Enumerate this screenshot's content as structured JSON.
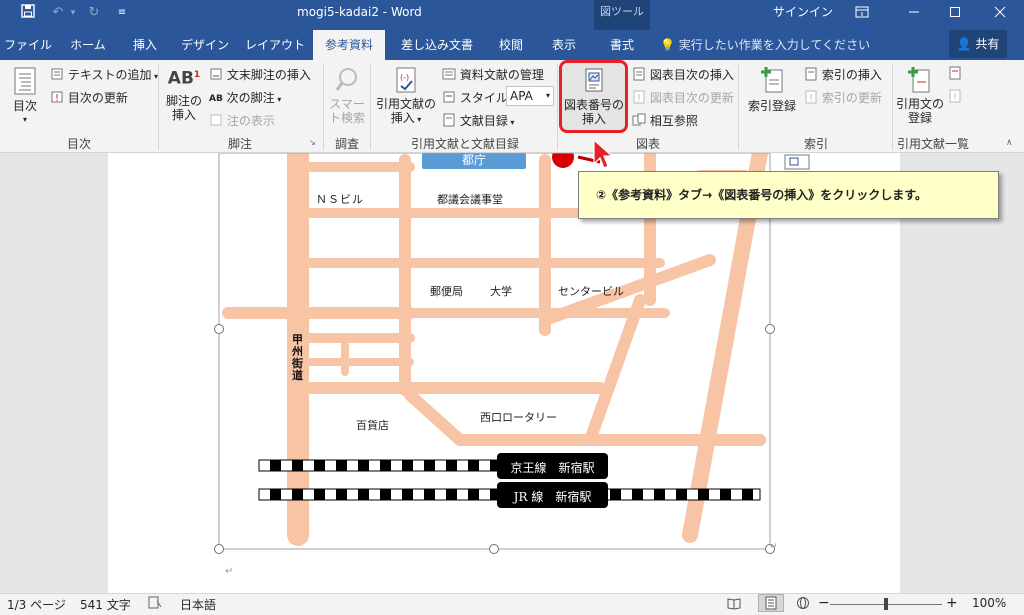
{
  "window": {
    "title": "mogi5-kadai2  -  Word",
    "signin": "サインイン",
    "context_tab_group": "図ツール"
  },
  "tabs": [
    "ファイル",
    "ホーム",
    "挿入",
    "デザイン",
    "レイアウト",
    "参考資料",
    "差し込み文書",
    "校閲",
    "表示",
    "書式"
  ],
  "active_tab": "参考資料",
  "tell_me": "実行したい作業を入力してください",
  "share": "共有",
  "ribbon": {
    "toc": {
      "toc_button": "目次",
      "add_text": "テキストの追加",
      "update_toc": "目次の更新",
      "label": "目次"
    },
    "footnotes": {
      "insert_footnote_1": "脚注の",
      "insert_footnote_2": "挿入",
      "insert_endnote": "文末脚注の挿入",
      "next_footnote": "次の脚注",
      "show_notes": "注の表示",
      "label": "脚注"
    },
    "research": {
      "smart_1": "スマー",
      "smart_2": "ト検索",
      "label": "調査"
    },
    "citations": {
      "insert_citation_1": "引用文献の",
      "insert_citation_2": "挿入",
      "manage_sources": "資料文献の管理",
      "style_label": "スタイル:",
      "style_value": "APA",
      "bibliography": "文献目録",
      "label": "引用文献と文献目録"
    },
    "captions": {
      "insert_caption_1": "図表番号の",
      "insert_caption_2": "挿入",
      "insert_tof": "図表目次の挿入",
      "update_table": "図表目次の更新",
      "cross_reference": "相互参照",
      "label": "図表"
    },
    "index": {
      "mark_entry": "索引登録",
      "insert_index": "索引の挿入",
      "update_index": "索引の更新",
      "label": "索引"
    },
    "toa": {
      "mark_citation_1": "引用文の",
      "mark_citation_2": "登録",
      "label": "引用文献一覧"
    }
  },
  "callout": "②《参考資料》タブ→《図表番号の挿入》をクリックします。",
  "map": {
    "tocho": "都庁",
    "ns_building": "ＮＳビル",
    "assembly": "都議会議事堂",
    "post_office": "郵便局",
    "university": "大学",
    "center_building": "センタービル",
    "koshu_kaido": "甲州街道",
    "dept_store": "百貨店",
    "west_rotary": "西口ロータリー",
    "keio_line": "京王線　新宿駅",
    "jr_line": "JR 線　新宿駅"
  },
  "status": {
    "page": "1/3 ページ",
    "words": "541 文字",
    "language": "日本語",
    "zoom": "100%"
  }
}
